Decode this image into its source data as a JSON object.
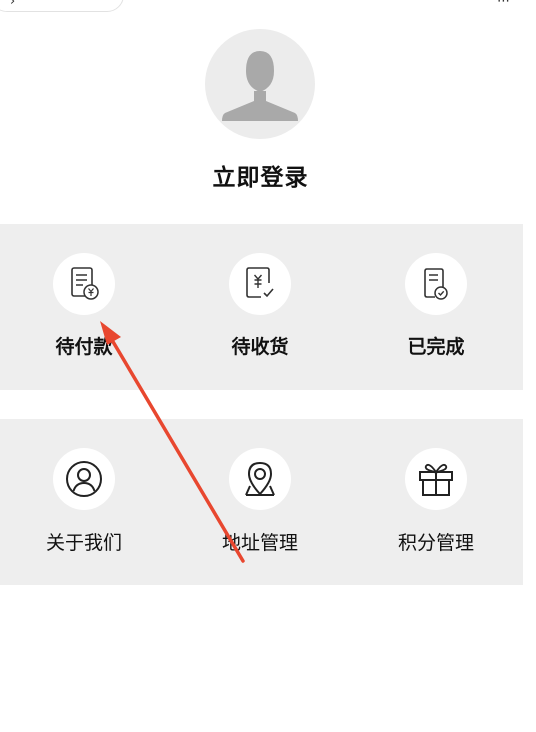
{
  "profile": {
    "avatar_icon": "user-silhouette-icon",
    "login_label": "立即登录"
  },
  "orders": [
    {
      "label": "待付款",
      "icon": "pending-payment-icon"
    },
    {
      "label": "待收货",
      "icon": "pending-receipt-icon"
    },
    {
      "label": "已完成",
      "icon": "completed-order-icon"
    }
  ],
  "services": [
    {
      "label": "关于我们",
      "icon": "about-us-icon"
    },
    {
      "label": "地址管理",
      "icon": "location-pin-icon"
    },
    {
      "label": "积分管理",
      "icon": "gift-icon"
    }
  ],
  "annotation": {
    "type": "arrow",
    "color": "#e8472f"
  },
  "colors": {
    "panel_bg": "#eeeeee",
    "avatar_bg": "#ececec",
    "text": "#111111"
  }
}
